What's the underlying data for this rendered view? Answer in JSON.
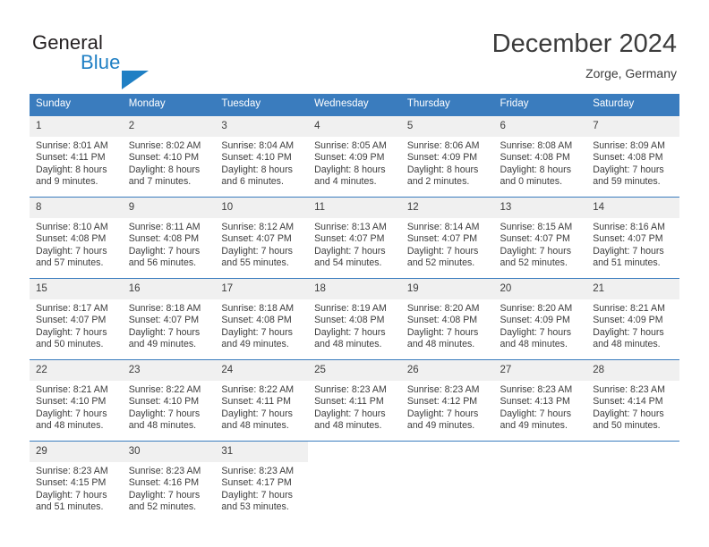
{
  "brand": {
    "name_part1": "General",
    "name_part2": "Blue",
    "logo_icon": "triangle-flag-icon",
    "color_dark": "#231f20",
    "color_blue": "#1f7fc4"
  },
  "header": {
    "title": "December 2024",
    "subtitle": "Zorge, Germany"
  },
  "theme": {
    "header_bg": "#3a7cbe",
    "daynum_bg": "#f0f0f0",
    "text": "#3c3c3c",
    "rule": "#3a7cbe"
  },
  "weekdays": [
    "Sunday",
    "Monday",
    "Tuesday",
    "Wednesday",
    "Thursday",
    "Friday",
    "Saturday"
  ],
  "weeks": [
    [
      {
        "day": "1",
        "sunrise": "Sunrise: 8:01 AM",
        "sunset": "Sunset: 4:11 PM",
        "daylight1": "Daylight: 8 hours",
        "daylight2": "and 9 minutes."
      },
      {
        "day": "2",
        "sunrise": "Sunrise: 8:02 AM",
        "sunset": "Sunset: 4:10 PM",
        "daylight1": "Daylight: 8 hours",
        "daylight2": "and 7 minutes."
      },
      {
        "day": "3",
        "sunrise": "Sunrise: 8:04 AM",
        "sunset": "Sunset: 4:10 PM",
        "daylight1": "Daylight: 8 hours",
        "daylight2": "and 6 minutes."
      },
      {
        "day": "4",
        "sunrise": "Sunrise: 8:05 AM",
        "sunset": "Sunset: 4:09 PM",
        "daylight1": "Daylight: 8 hours",
        "daylight2": "and 4 minutes."
      },
      {
        "day": "5",
        "sunrise": "Sunrise: 8:06 AM",
        "sunset": "Sunset: 4:09 PM",
        "daylight1": "Daylight: 8 hours",
        "daylight2": "and 2 minutes."
      },
      {
        "day": "6",
        "sunrise": "Sunrise: 8:08 AM",
        "sunset": "Sunset: 4:08 PM",
        "daylight1": "Daylight: 8 hours",
        "daylight2": "and 0 minutes."
      },
      {
        "day": "7",
        "sunrise": "Sunrise: 8:09 AM",
        "sunset": "Sunset: 4:08 PM",
        "daylight1": "Daylight: 7 hours",
        "daylight2": "and 59 minutes."
      }
    ],
    [
      {
        "day": "8",
        "sunrise": "Sunrise: 8:10 AM",
        "sunset": "Sunset: 4:08 PM",
        "daylight1": "Daylight: 7 hours",
        "daylight2": "and 57 minutes."
      },
      {
        "day": "9",
        "sunrise": "Sunrise: 8:11 AM",
        "sunset": "Sunset: 4:08 PM",
        "daylight1": "Daylight: 7 hours",
        "daylight2": "and 56 minutes."
      },
      {
        "day": "10",
        "sunrise": "Sunrise: 8:12 AM",
        "sunset": "Sunset: 4:07 PM",
        "daylight1": "Daylight: 7 hours",
        "daylight2": "and 55 minutes."
      },
      {
        "day": "11",
        "sunrise": "Sunrise: 8:13 AM",
        "sunset": "Sunset: 4:07 PM",
        "daylight1": "Daylight: 7 hours",
        "daylight2": "and 54 minutes."
      },
      {
        "day": "12",
        "sunrise": "Sunrise: 8:14 AM",
        "sunset": "Sunset: 4:07 PM",
        "daylight1": "Daylight: 7 hours",
        "daylight2": "and 52 minutes."
      },
      {
        "day": "13",
        "sunrise": "Sunrise: 8:15 AM",
        "sunset": "Sunset: 4:07 PM",
        "daylight1": "Daylight: 7 hours",
        "daylight2": "and 52 minutes."
      },
      {
        "day": "14",
        "sunrise": "Sunrise: 8:16 AM",
        "sunset": "Sunset: 4:07 PM",
        "daylight1": "Daylight: 7 hours",
        "daylight2": "and 51 minutes."
      }
    ],
    [
      {
        "day": "15",
        "sunrise": "Sunrise: 8:17 AM",
        "sunset": "Sunset: 4:07 PM",
        "daylight1": "Daylight: 7 hours",
        "daylight2": "and 50 minutes."
      },
      {
        "day": "16",
        "sunrise": "Sunrise: 8:18 AM",
        "sunset": "Sunset: 4:07 PM",
        "daylight1": "Daylight: 7 hours",
        "daylight2": "and 49 minutes."
      },
      {
        "day": "17",
        "sunrise": "Sunrise: 8:18 AM",
        "sunset": "Sunset: 4:08 PM",
        "daylight1": "Daylight: 7 hours",
        "daylight2": "and 49 minutes."
      },
      {
        "day": "18",
        "sunrise": "Sunrise: 8:19 AM",
        "sunset": "Sunset: 4:08 PM",
        "daylight1": "Daylight: 7 hours",
        "daylight2": "and 48 minutes."
      },
      {
        "day": "19",
        "sunrise": "Sunrise: 8:20 AM",
        "sunset": "Sunset: 4:08 PM",
        "daylight1": "Daylight: 7 hours",
        "daylight2": "and 48 minutes."
      },
      {
        "day": "20",
        "sunrise": "Sunrise: 8:20 AM",
        "sunset": "Sunset: 4:09 PM",
        "daylight1": "Daylight: 7 hours",
        "daylight2": "and 48 minutes."
      },
      {
        "day": "21",
        "sunrise": "Sunrise: 8:21 AM",
        "sunset": "Sunset: 4:09 PM",
        "daylight1": "Daylight: 7 hours",
        "daylight2": "and 48 minutes."
      }
    ],
    [
      {
        "day": "22",
        "sunrise": "Sunrise: 8:21 AM",
        "sunset": "Sunset: 4:10 PM",
        "daylight1": "Daylight: 7 hours",
        "daylight2": "and 48 minutes."
      },
      {
        "day": "23",
        "sunrise": "Sunrise: 8:22 AM",
        "sunset": "Sunset: 4:10 PM",
        "daylight1": "Daylight: 7 hours",
        "daylight2": "and 48 minutes."
      },
      {
        "day": "24",
        "sunrise": "Sunrise: 8:22 AM",
        "sunset": "Sunset: 4:11 PM",
        "daylight1": "Daylight: 7 hours",
        "daylight2": "and 48 minutes."
      },
      {
        "day": "25",
        "sunrise": "Sunrise: 8:23 AM",
        "sunset": "Sunset: 4:11 PM",
        "daylight1": "Daylight: 7 hours",
        "daylight2": "and 48 minutes."
      },
      {
        "day": "26",
        "sunrise": "Sunrise: 8:23 AM",
        "sunset": "Sunset: 4:12 PM",
        "daylight1": "Daylight: 7 hours",
        "daylight2": "and 49 minutes."
      },
      {
        "day": "27",
        "sunrise": "Sunrise: 8:23 AM",
        "sunset": "Sunset: 4:13 PM",
        "daylight1": "Daylight: 7 hours",
        "daylight2": "and 49 minutes."
      },
      {
        "day": "28",
        "sunrise": "Sunrise: 8:23 AM",
        "sunset": "Sunset: 4:14 PM",
        "daylight1": "Daylight: 7 hours",
        "daylight2": "and 50 minutes."
      }
    ],
    [
      {
        "day": "29",
        "sunrise": "Sunrise: 8:23 AM",
        "sunset": "Sunset: 4:15 PM",
        "daylight1": "Daylight: 7 hours",
        "daylight2": "and 51 minutes."
      },
      {
        "day": "30",
        "sunrise": "Sunrise: 8:23 AM",
        "sunset": "Sunset: 4:16 PM",
        "daylight1": "Daylight: 7 hours",
        "daylight2": "and 52 minutes."
      },
      {
        "day": "31",
        "sunrise": "Sunrise: 8:23 AM",
        "sunset": "Sunset: 4:17 PM",
        "daylight1": "Daylight: 7 hours",
        "daylight2": "and 53 minutes."
      },
      {
        "day": "",
        "sunrise": "",
        "sunset": "",
        "daylight1": "",
        "daylight2": ""
      },
      {
        "day": "",
        "sunrise": "",
        "sunset": "",
        "daylight1": "",
        "daylight2": ""
      },
      {
        "day": "",
        "sunrise": "",
        "sunset": "",
        "daylight1": "",
        "daylight2": ""
      },
      {
        "day": "",
        "sunrise": "",
        "sunset": "",
        "daylight1": "",
        "daylight2": ""
      }
    ]
  ]
}
